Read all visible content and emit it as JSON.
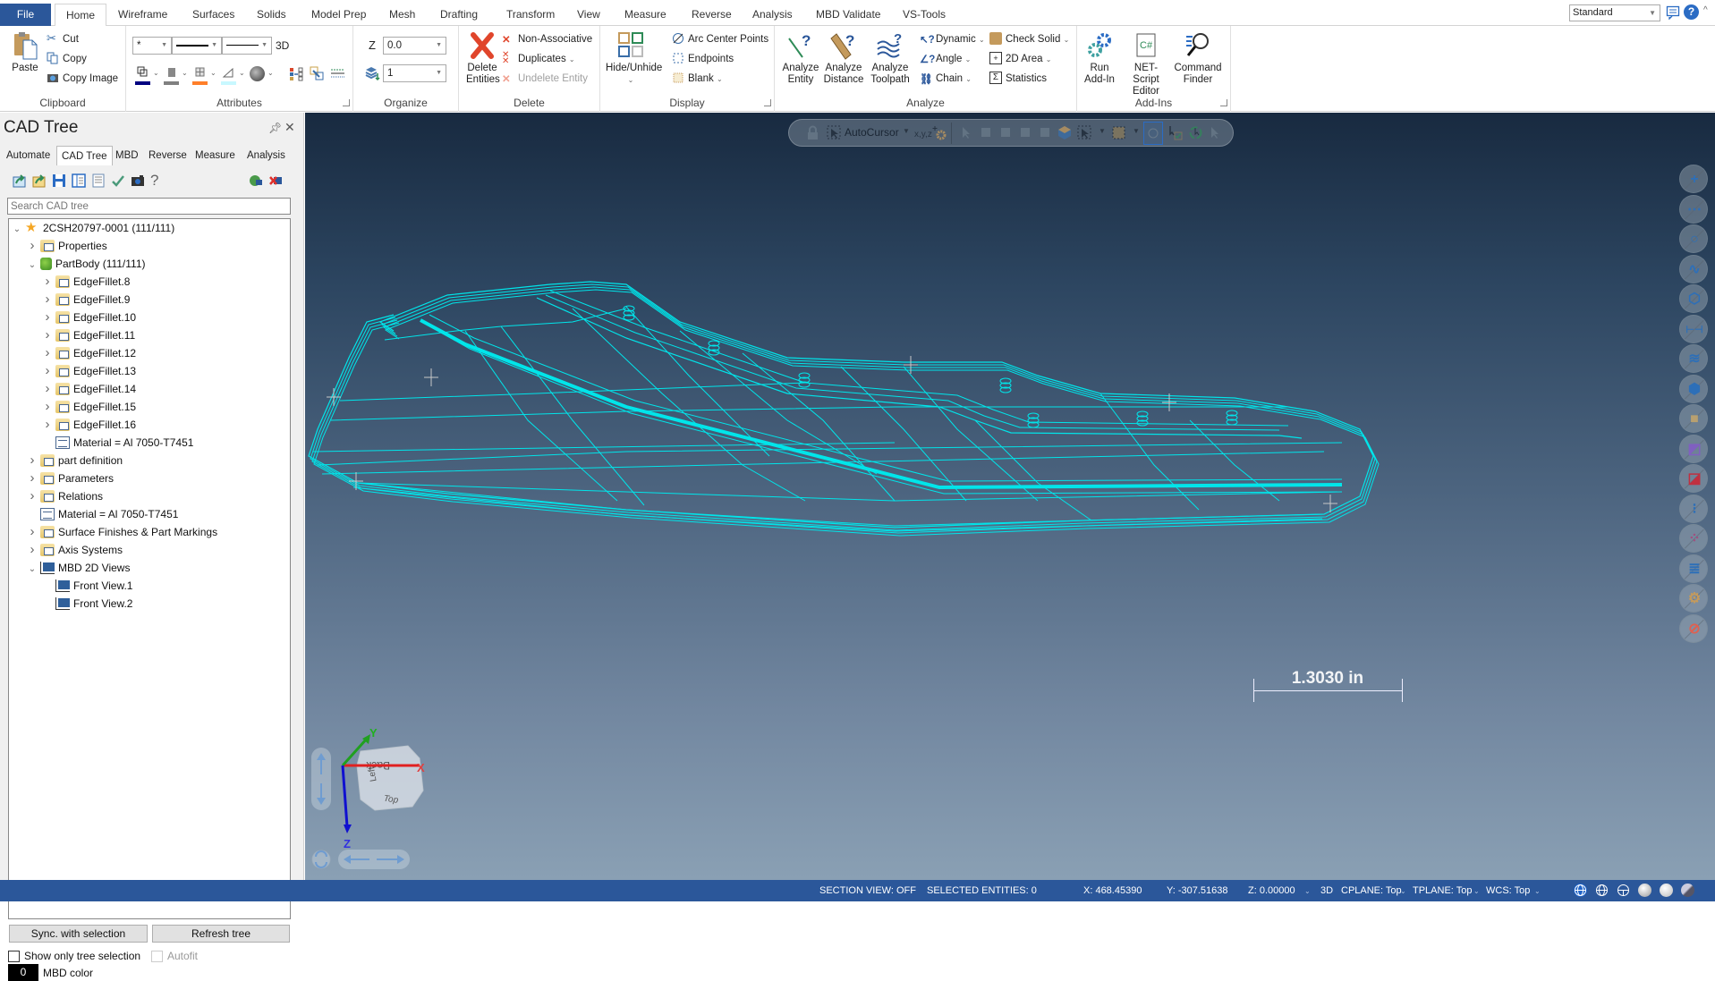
{
  "ribbon_tabs": [
    {
      "label": "File"
    },
    {
      "label": "Home"
    },
    {
      "label": "Wireframe"
    },
    {
      "label": "Surfaces"
    },
    {
      "label": "Solids"
    },
    {
      "label": "Model Prep"
    },
    {
      "label": "Mesh"
    },
    {
      "label": "Drafting"
    },
    {
      "label": "Transform"
    },
    {
      "label": "View"
    },
    {
      "label": "Measure"
    },
    {
      "label": "Reverse"
    },
    {
      "label": "Analysis"
    },
    {
      "label": "MBD Validate"
    },
    {
      "label": "VS-Tools"
    }
  ],
  "active_tab": "Home",
  "workspace_select": "Standard",
  "ribbon": {
    "clipboard": {
      "label": "Clipboard",
      "paste": "Paste",
      "cut": "Cut",
      "copy": "Copy",
      "copy_image": "Copy Image"
    },
    "attributes": {
      "label": "Attributes",
      "point_style": "*",
      "mode_3d": "3D",
      "colors": {
        "wireframe": "#000080",
        "solid": "#808080",
        "surface": "#ff7f2a",
        "line": "#c8f8ff"
      }
    },
    "organize": {
      "label": "Organize",
      "z_label": "Z",
      "z_value": "0.0",
      "level_value": "1"
    },
    "delete": {
      "label": "Delete",
      "delete_entities": "Delete Entities",
      "non_associative": "Non-Associative",
      "duplicates": "Duplicates",
      "undelete_entity": "Undelete Entity"
    },
    "display": {
      "label": "Display",
      "hide_unhide": "Hide/Unhide",
      "arc_center_points": "Arc Center Points",
      "endpoints": "Endpoints",
      "blank": "Blank"
    },
    "analyze": {
      "label": "Analyze",
      "analyze_entity": "Analyze Entity",
      "analyze_distance": "Analyze Distance",
      "analyze_toolpath": "Analyze Toolpath",
      "dynamic": "Dynamic",
      "angle": "Angle",
      "chain": "Chain",
      "check_solid": "Check Solid",
      "area_2d": "2D Area",
      "statistics": "Statistics"
    },
    "addins": {
      "label": "Add-Ins",
      "run_addin": "Run Add-In",
      "net_script": "NET-Script Editor",
      "command_finder": "Command Finder"
    }
  },
  "left_panel": {
    "title": "CAD Tree",
    "tabs": [
      {
        "label": "Automate"
      },
      {
        "label": "CAD Tree"
      },
      {
        "label": "MBD"
      },
      {
        "label": "Reverse"
      },
      {
        "label": "Measure"
      },
      {
        "label": "Analysis"
      }
    ],
    "search_placeholder": "Search CAD tree",
    "tree": [
      {
        "label": "2CSH20797-0001 (111/111)",
        "level": 0,
        "expander": "open",
        "icon": "star"
      },
      {
        "label": "Properties",
        "level": 1,
        "expander": "closed",
        "icon": "folder"
      },
      {
        "label": "PartBody (111/111)",
        "level": 1,
        "expander": "open",
        "icon": "body"
      },
      {
        "label": "EdgeFillet.8",
        "level": 2,
        "expander": "closed",
        "icon": "folder"
      },
      {
        "label": "EdgeFillet.9",
        "level": 2,
        "expander": "closed",
        "icon": "folder"
      },
      {
        "label": "EdgeFillet.10",
        "level": 2,
        "expander": "closed",
        "icon": "folder"
      },
      {
        "label": "EdgeFillet.11",
        "level": 2,
        "expander": "closed",
        "icon": "folder"
      },
      {
        "label": "EdgeFillet.12",
        "level": 2,
        "expander": "closed",
        "icon": "folder"
      },
      {
        "label": "EdgeFillet.13",
        "level": 2,
        "expander": "closed",
        "icon": "folder"
      },
      {
        "label": "EdgeFillet.14",
        "level": 2,
        "expander": "closed",
        "icon": "folder"
      },
      {
        "label": "EdgeFillet.15",
        "level": 2,
        "expander": "closed",
        "icon": "folder"
      },
      {
        "label": "EdgeFillet.16",
        "level": 2,
        "expander": "closed",
        "icon": "folder"
      },
      {
        "label": "Material = Al 7050-T7451",
        "level": 2,
        "expander": "none",
        "icon": "list"
      },
      {
        "label": "part definition",
        "level": 1,
        "expander": "closed",
        "icon": "folder"
      },
      {
        "label": "Parameters",
        "level": 1,
        "expander": "closed",
        "icon": "folder"
      },
      {
        "label": "Relations",
        "level": 1,
        "expander": "closed",
        "icon": "folder"
      },
      {
        "label": "Material = Al 7050-T7451",
        "level": 1,
        "expander": "none",
        "icon": "list"
      },
      {
        "label": "Surface Finishes & Part Markings",
        "level": 1,
        "expander": "closed",
        "icon": "folder"
      },
      {
        "label": "Axis Systems",
        "level": 1,
        "expander": "closed",
        "icon": "folder"
      },
      {
        "label": "MBD 2D Views",
        "level": 1,
        "expander": "open",
        "icon": "view"
      },
      {
        "label": "Front View.1",
        "level": 2,
        "expander": "none",
        "icon": "view"
      },
      {
        "label": "Front View.2",
        "level": 2,
        "expander": "none",
        "icon": "view"
      }
    ],
    "sync_button": "Sync. with selection",
    "refresh_button": "Refresh tree",
    "show_only_tree_selection": {
      "label": "Show only tree selection",
      "checked": false
    },
    "autofit": {
      "label": "Autofit",
      "checked": false,
      "enabled": false
    },
    "mbd_color": {
      "value": "0",
      "label": "MBD color"
    }
  },
  "viewport": {
    "autocursor_label": "AutoCursor",
    "scale": "1.3030 in",
    "wire_color": "#00e5ea",
    "cube_faces": {
      "back": "Back",
      "left": "Left",
      "top": "Top"
    },
    "axes": {
      "x": "X",
      "y": "Y",
      "z": "Z"
    }
  },
  "status_bar": {
    "section_view": "SECTION VIEW: OFF",
    "selected_entities": "SELECTED ENTITIES: 0",
    "x": "X:  468.45390",
    "y": "Y:  -307.51638",
    "z": "Z:  0.00000",
    "mode": "3D",
    "cplane": "CPLANE: Top",
    "tplane": "TPLANE: Top",
    "wcs": "WCS: Top"
  }
}
